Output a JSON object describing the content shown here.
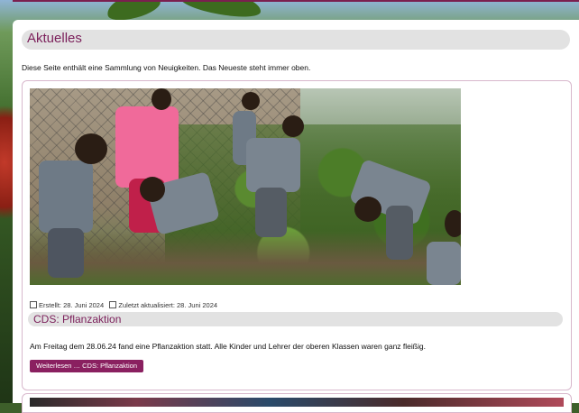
{
  "page": {
    "title": "Aktuelles",
    "intro": "Diese Seite enthält eine Sammlung von Neuigkeiten. Das Neueste steht immer oben."
  },
  "article": {
    "created_label": "Erstellt: 28. Juni 2024",
    "updated_label": "Zuletzt aktualisiert: 28. Juni 2024",
    "title": "CDS: Pflanzaktion",
    "text": "Am Freitag dem 28.06.24 fand eine Pflanzaktion statt. Alle Kinder und Lehrer der oberen Klassen waren ganz fleißig.",
    "read_more_label": "Weiterlesen … CDS: Pflanzaktion"
  },
  "colors": {
    "accent": "#7b1f5a",
    "button": "#8a2060",
    "title_bar": "#e2e2e2"
  }
}
